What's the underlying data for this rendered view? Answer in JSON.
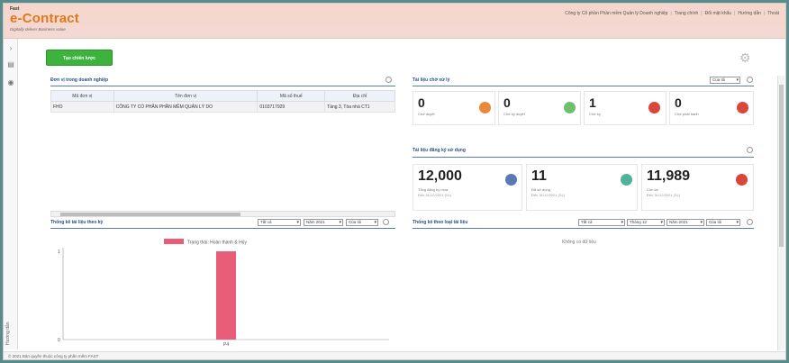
{
  "header": {
    "logo_prefix": "Fast",
    "logo_name": "e-Contract",
    "tagline": "Digitally deliver Business value",
    "nav": [
      "Công ty Cổ phần Phần mềm Quản lý Doanh nghiệp",
      "Trang chính",
      "Đổi mật khẩu",
      "Hướng dẫn",
      "Thoát"
    ]
  },
  "toolbar": {
    "create_label": "Tạo chiến lược"
  },
  "partners_panel": {
    "title": "Đơn vị trong doanh nghiệp",
    "columns": [
      "Mã đơn vị",
      "Tên đơn vị",
      "Mã số thuế",
      "Địa chỉ"
    ],
    "rows": [
      [
        "FHO",
        "CÔNG TY CỔ PHẦN PHẦN MỀM QUẢN LÝ DO",
        "0103717929",
        "Tầng 3, Tòa nhà CT1"
      ]
    ]
  },
  "docs_panel": {
    "title": "Tài liệu chờ xử lý",
    "select": "Của tôi",
    "cards": [
      {
        "value": "0",
        "label": "Chờ duyệt",
        "color": "#e88a3a"
      },
      {
        "value": "0",
        "label": "Chờ ký duyệt",
        "color": "#6fbf6f"
      },
      {
        "value": "1",
        "label": "Chờ ký",
        "color": "#d9463a"
      },
      {
        "value": "0",
        "label": "Chờ phát hành",
        "color": "#d9463a"
      }
    ]
  },
  "usage_panel": {
    "title": "Tài liệu đăng ký sử dụng",
    "cards": [
      {
        "value": "12,000",
        "label": "Tổng đăng ký mua",
        "sub": "Đến 31/12/2021 (SL)",
        "color": "#5a7bb0"
      },
      {
        "value": "11",
        "label": "Đã sử dụng",
        "sub": "Đến 31/12/2021 (SL)",
        "color": "#4fb39a"
      },
      {
        "value": "11,989",
        "label": "Còn lại",
        "sub": "Đến 31/12/2021 (SL)",
        "color": "#d9463a"
      }
    ]
  },
  "left_chart_panel": {
    "title": "Thống kê tài liệu theo kỳ",
    "selects": [
      "Tất cả",
      "Năm 2021",
      "Của tôi"
    ],
    "legend": "Trạng thái: Hoàn thành & Hủy"
  },
  "right_chart_panel": {
    "title": "Thống kê theo loại tài liệu",
    "selects": [
      "Tất cả",
      "Tháng 12",
      "Năm 2021",
      "Của tôi"
    ],
    "empty_text": "Không có dữ liệu"
  },
  "sidebar": {
    "vertical_text": "Hướng dẫn"
  },
  "footer": {
    "text": "© 2021 Bản quyền thuộc công ty phần mềm FAST"
  },
  "chart_data": {
    "type": "bar",
    "categories": [
      "P4"
    ],
    "series": [
      {
        "name": "Trạng thái: Hoàn thành & Hủy",
        "values": [
          1
        ]
      }
    ],
    "ylim": [
      0,
      1
    ],
    "yticks": [
      "1",
      "0"
    ],
    "color": "#ea5d78"
  }
}
